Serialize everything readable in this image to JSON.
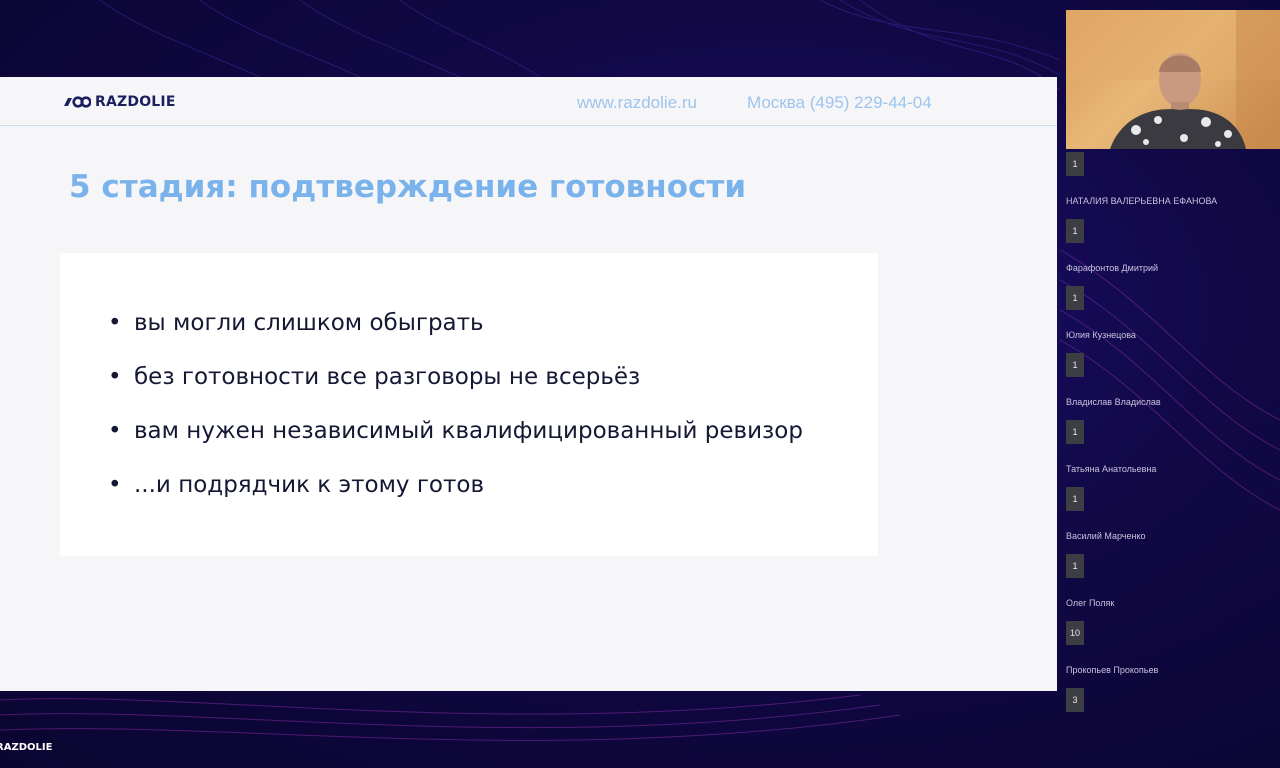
{
  "slide": {
    "logo_text": "RAZDOLIE",
    "site_url": "www.razdolie.ru",
    "phone": "Москва (495) 229-44-04",
    "title": "5 стадия: подтверждение готовности",
    "bullets": [
      "вы могли слишком обыграть",
      "без готовности все разговоры не всерьёз",
      "вам нужен независимый квалифицированный ревизор",
      "...и подрядчик к этому готов"
    ]
  },
  "bottom_logo_text": "RAZDOLIE",
  "participants": [
    {
      "badge": "1",
      "name": "НАТАЛИЯ ВАЛЕРЬЕВНА ЕФАНОВА"
    },
    {
      "badge": "1",
      "name": "Фарафонтов Дмитрий"
    },
    {
      "badge": "1",
      "name": "Юлия Кузнецова"
    },
    {
      "badge": "1",
      "name": "Владислав Владислав"
    },
    {
      "badge": "1",
      "name": "Татьяна Анатольевна"
    },
    {
      "badge": "1",
      "name": "Василий Марченко"
    },
    {
      "badge": "1",
      "name": "Олег Поляк"
    },
    {
      "badge": "10",
      "name": "Прокопьев Прокопьев"
    },
    {
      "badge": "3",
      "name": ""
    }
  ]
}
